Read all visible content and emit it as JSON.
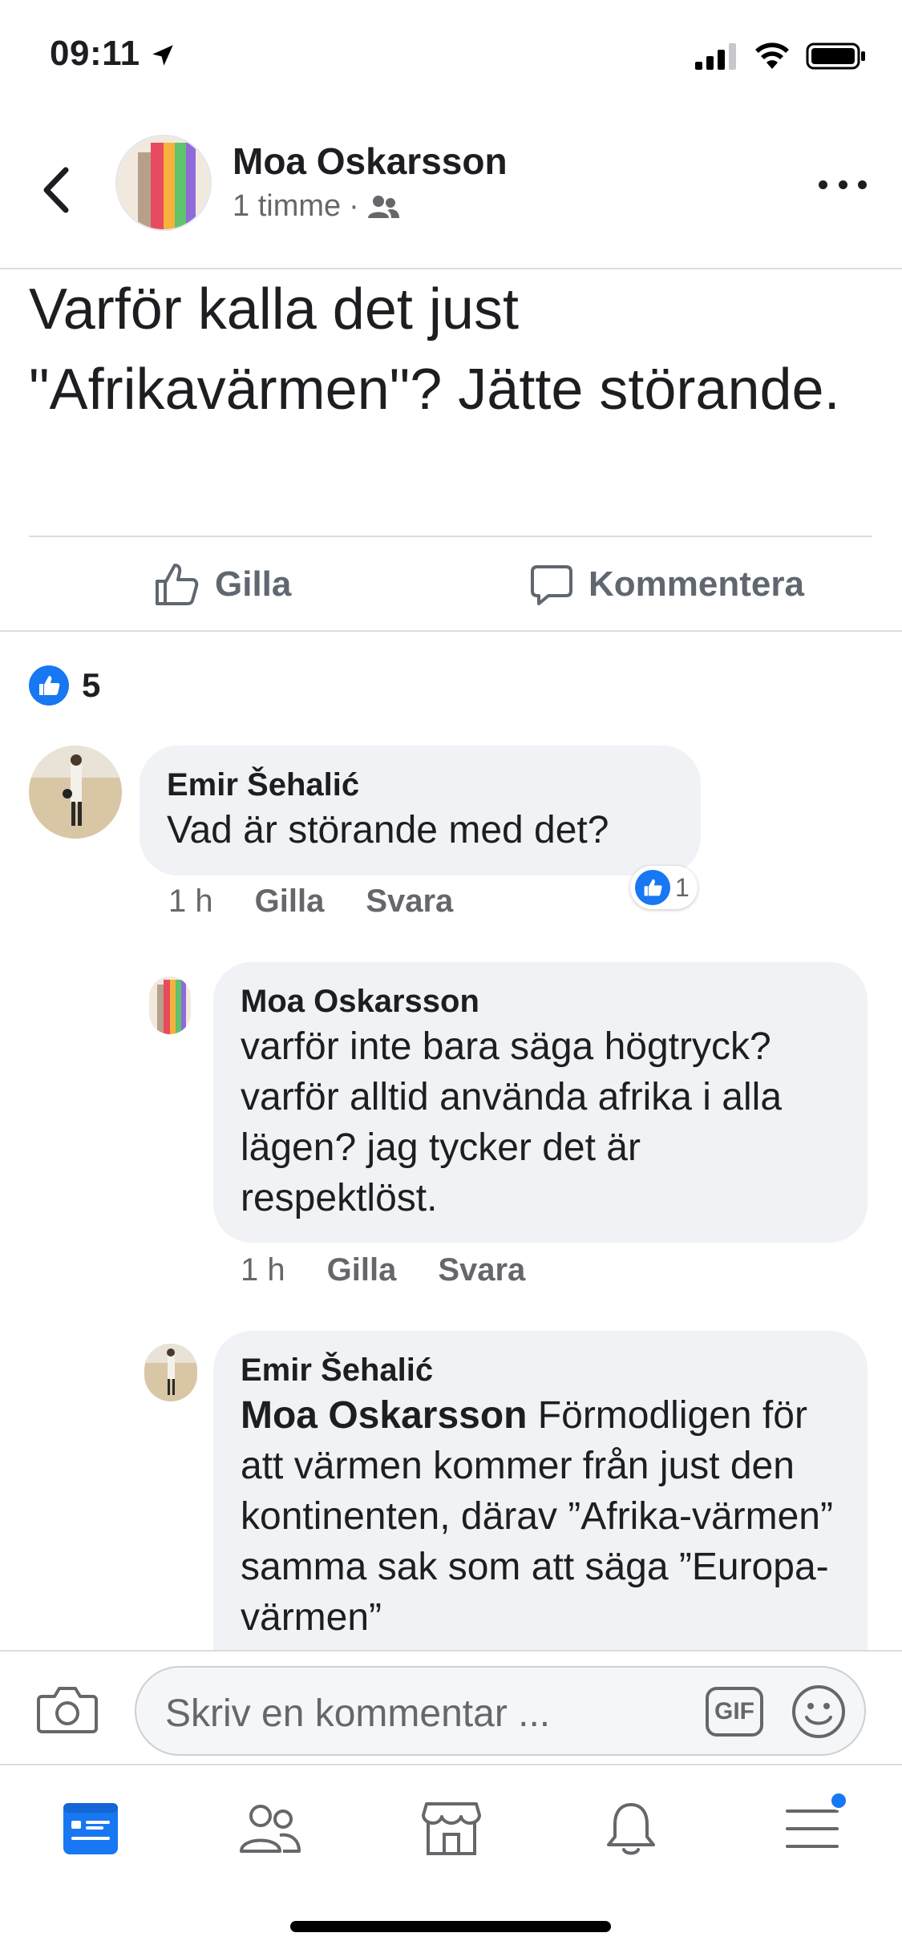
{
  "status_bar": {
    "time": "09:11"
  },
  "header": {
    "author": "Moa Oskarsson",
    "time": "1 timme",
    "separator": "·",
    "audience_icon": "friends-icon"
  },
  "post": {
    "text": "Varför kalla det just \"Afrikavärmen\"? Jätte störande.",
    "like_label": "Gilla",
    "comment_label": "Kommentera",
    "reaction_count": "5"
  },
  "comments": [
    {
      "author": "Emir Šehalić",
      "text": "Vad är störande med det?",
      "time": "1 h",
      "like": "Gilla",
      "reply": "Svara",
      "reaction_count": "1"
    },
    {
      "author": "Moa Oskarsson",
      "text": "varför inte bara säga högtryck? varför alltid använda afrika i alla lägen? jag tycker det är respektlöst.",
      "time": "1 h",
      "like": "Gilla",
      "reply": "Svara"
    },
    {
      "author": "Emir Šehalić",
      "mention": "Moa Oskarsson",
      "text": " Förmodligen för att värmen kommer från just den kontinenten, därav ”Afrika-värmen” samma sak som att säga ”Europa-värmen”"
    }
  ],
  "composer": {
    "placeholder": "Skriv en kommentar ...",
    "gif_label": "GIF"
  },
  "tabbar": {
    "items": [
      "news-feed-icon",
      "friends-icon",
      "marketplace-icon",
      "notifications-icon",
      "menu-icon"
    ],
    "active": "news-feed-icon",
    "accent": "#1877f2"
  }
}
